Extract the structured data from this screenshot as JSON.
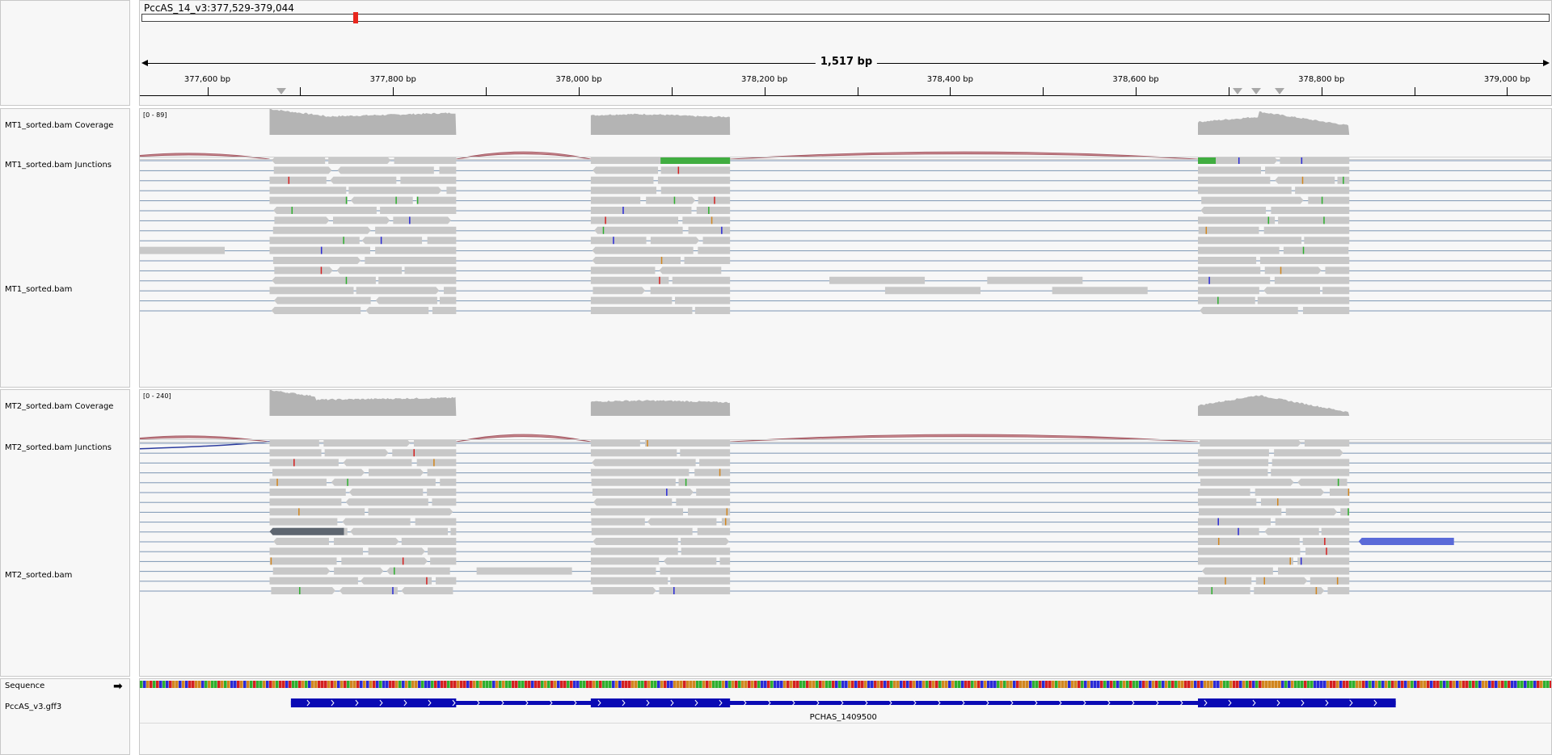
{
  "locus": "PccAS_14_v3:377,529-379,044",
  "view": {
    "start": 377529,
    "end": 379044
  },
  "span_label": "1,517 bp",
  "ruler": {
    "ticks": [
      {
        "label": "377,600 bp",
        "pos": 377600
      },
      {
        "label": "377,800 bp",
        "pos": 377800
      },
      {
        "label": "378,000 bp",
        "pos": 378000
      },
      {
        "label": "378,200 bp",
        "pos": 378200
      },
      {
        "label": "378,400 bp",
        "pos": 378400
      },
      {
        "label": "378,600 bp",
        "pos": 378600
      },
      {
        "label": "378,800 bp",
        "pos": 378800
      },
      {
        "label": "379,000 bp",
        "pos": 379000
      }
    ],
    "minor_ticks": [
      377700,
      377900,
      378100,
      378300,
      378500,
      378700,
      378900
    ],
    "feature_markers": [
      377680,
      378710,
      378730,
      378755
    ]
  },
  "ideogram_marker_pos": 0.15,
  "tracks": {
    "mt1_coverage": {
      "label": "MT1_sorted.bam Coverage",
      "range": "[0 - 89]"
    },
    "mt1_junctions": {
      "label": "MT1_sorted.bam Junctions"
    },
    "mt1_alignments": {
      "label": "MT1_sorted.bam"
    },
    "mt2_coverage": {
      "label": "MT2_sorted.bam Coverage",
      "range": "[0 - 240]"
    },
    "mt2_junctions": {
      "label": "MT2_sorted.bam Junctions"
    },
    "mt2_alignments": {
      "label": "MT2_sorted.bam"
    },
    "sequence": {
      "label": "Sequence",
      "arrow": "➡"
    },
    "annotation": {
      "label": "PccAS_v3.gff3",
      "gene": "PCHAS_1409500"
    }
  },
  "exons": [
    {
      "start": 377667,
      "end": 377868
    },
    {
      "start": 378013,
      "end": 378163
    },
    {
      "start": 378667,
      "end": 378830
    }
  ],
  "introns": [
    {
      "start": 377868,
      "end": 378013
    },
    {
      "start": 378163,
      "end": 378667
    }
  ],
  "colors": {
    "coverage": "#b4b4b4",
    "junction_plus": "#c7868c",
    "junction_minus": "#2b3b9e",
    "read": "#c8c8c8",
    "read_line": "#7d96b4",
    "gene": "#0a0ab4",
    "soft_clip_green": "#40ad40",
    "highlight_blue": "#5a6ad8",
    "dark_read": "#5e6670",
    "seq_A": "#2eaf2e",
    "seq_C": "#2a2ad6",
    "seq_G": "#d1861f",
    "seq_T": "#d42020"
  }
}
